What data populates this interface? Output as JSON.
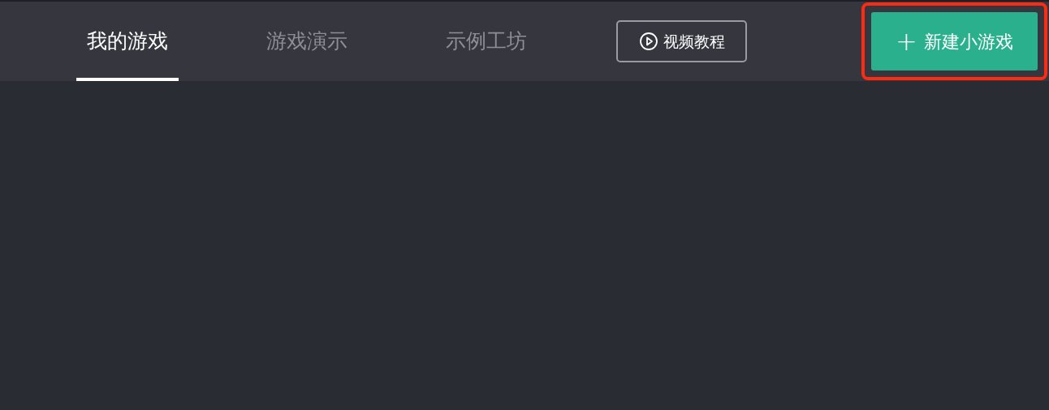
{
  "tabs": [
    {
      "label": "我的游戏",
      "selected": true
    },
    {
      "label": "游戏演示",
      "selected": false
    },
    {
      "label": "示例工坊",
      "selected": false
    }
  ],
  "tutorial_button": {
    "label": "视频教程"
  },
  "new_button": {
    "icon": "+",
    "label": "新建小游戏",
    "highlighted": true
  }
}
